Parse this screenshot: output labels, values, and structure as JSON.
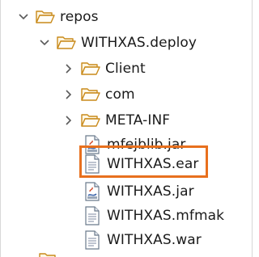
{
  "tree": {
    "root": {
      "label": "repos",
      "expanded": true
    },
    "project": {
      "label": "WITHXAS.deploy",
      "expanded": true
    },
    "folders": [
      {
        "label": "Client",
        "expanded": false
      },
      {
        "label": "com",
        "expanded": false
      },
      {
        "label": "META-INF",
        "expanded": false
      }
    ],
    "files": [
      {
        "label": "mfejblib.jar",
        "icon": "jar-file-icon"
      },
      {
        "label": "WITHXAS.ear",
        "icon": "text-file-icon",
        "highlighted": true
      },
      {
        "label": "WITHXAS.jar",
        "icon": "jar-file-icon"
      },
      {
        "label": "WITHXAS.mfmak",
        "icon": "text-file-icon"
      },
      {
        "label": "WITHXAS.war",
        "icon": "text-file-icon"
      }
    ]
  },
  "colors": {
    "highlight_border": "#e8701e",
    "folder_outline": "#c98a1a",
    "chevron": "#5a5a5a"
  }
}
